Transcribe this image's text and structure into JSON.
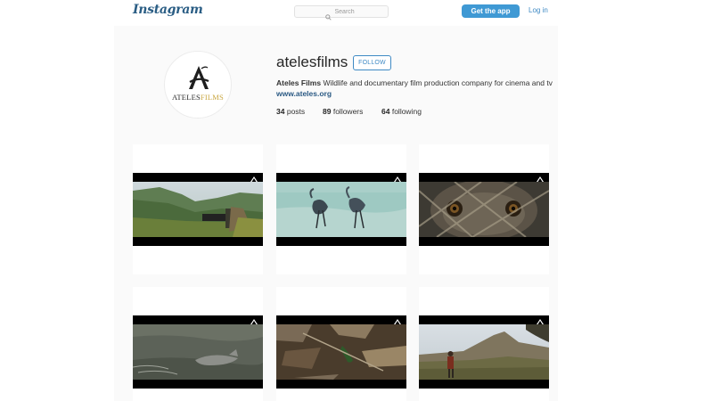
{
  "header": {
    "logo": "Instagram",
    "search_placeholder": "Search",
    "get_app_label": "Get the app",
    "login_label": "Log in"
  },
  "profile": {
    "username": "atelesfilms",
    "follow_label": "FOLLOW",
    "avatar_brand_part1": "ATELES",
    "avatar_brand_part2": "FILMS",
    "full_name": "Ateles Films",
    "bio": "Wildlife and documentary film production company for cinema and tv",
    "website": "www.ateles.org",
    "stats": {
      "posts_count": "34",
      "posts_label": "posts",
      "followers_count": "89",
      "followers_label": "followers",
      "following_count": "64",
      "following_label": "following"
    }
  },
  "posts": [
    {
      "subject": "mountain valley with film camera"
    },
    {
      "subject": "two herons in shallow water"
    },
    {
      "subject": "primate eyes behind branches"
    },
    {
      "subject": "river dolphin surfacing"
    },
    {
      "subject": "leaf litter forest floor"
    },
    {
      "subject": "hiker facing mountain peak"
    }
  ],
  "colors": {
    "accent": "#3f99d4",
    "link": "#3f8ac4",
    "panel_bg": "#fafafa",
    "brand_gold": "#c9a640"
  }
}
